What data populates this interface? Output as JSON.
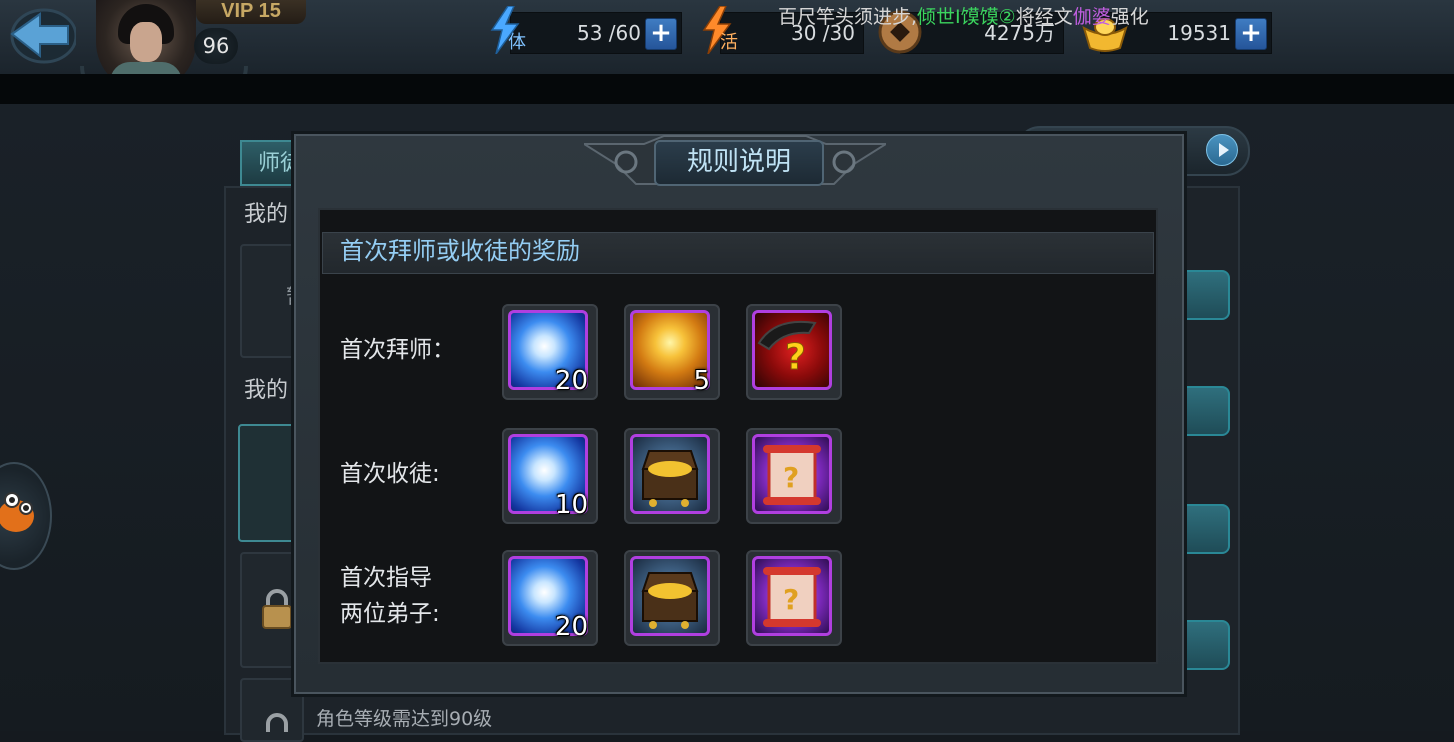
{
  "header": {
    "vip": "VIP 15",
    "level": "96",
    "stamina": {
      "label": "体",
      "value": "53 /60"
    },
    "vitality": {
      "label": "活",
      "value": "30 /30"
    },
    "coins": {
      "value": "4275万"
    },
    "gold": {
      "value": "19531"
    }
  },
  "marquee": {
    "part1": "百尺竿头须进步,",
    "player": "倾世I馍馍②",
    "part2": "将经文",
    "item": "伽婆",
    "part3": "强化"
  },
  "background": {
    "tab_label": "师徒",
    "section1": "我的",
    "section2": "我的",
    "cell_text": "暂",
    "bottom_note": "角色等级需达到90级"
  },
  "modal": {
    "title": "规则说明",
    "section_title": "首次拜师或收徒的奖励",
    "rows": [
      {
        "label": "首次拜师：",
        "items": [
          {
            "icon": "spirit-orb-icon",
            "count": "20"
          },
          {
            "icon": "golden-pearl-icon",
            "count": "5"
          },
          {
            "icon": "mystery-weapon-icon",
            "count": ""
          }
        ]
      },
      {
        "label": "首次收徒:",
        "items": [
          {
            "icon": "spirit-orb-icon",
            "count": "10"
          },
          {
            "icon": "treasure-chest-icon",
            "count": ""
          },
          {
            "icon": "mystery-scroll-icon",
            "count": ""
          }
        ]
      },
      {
        "label_line1": "首次指导",
        "label_line2": "两位弟子:",
        "items": [
          {
            "icon": "spirit-orb-icon",
            "count": "20"
          },
          {
            "icon": "treasure-chest-icon",
            "count": ""
          },
          {
            "icon": "mystery-scroll-icon",
            "count": ""
          }
        ]
      }
    ]
  },
  "colors": {
    "accent_blue": "#94cdf3",
    "item_border_purple": "#b03fe0",
    "marquee_green": "#3bd45e",
    "marquee_purple": "#c05ee0"
  }
}
